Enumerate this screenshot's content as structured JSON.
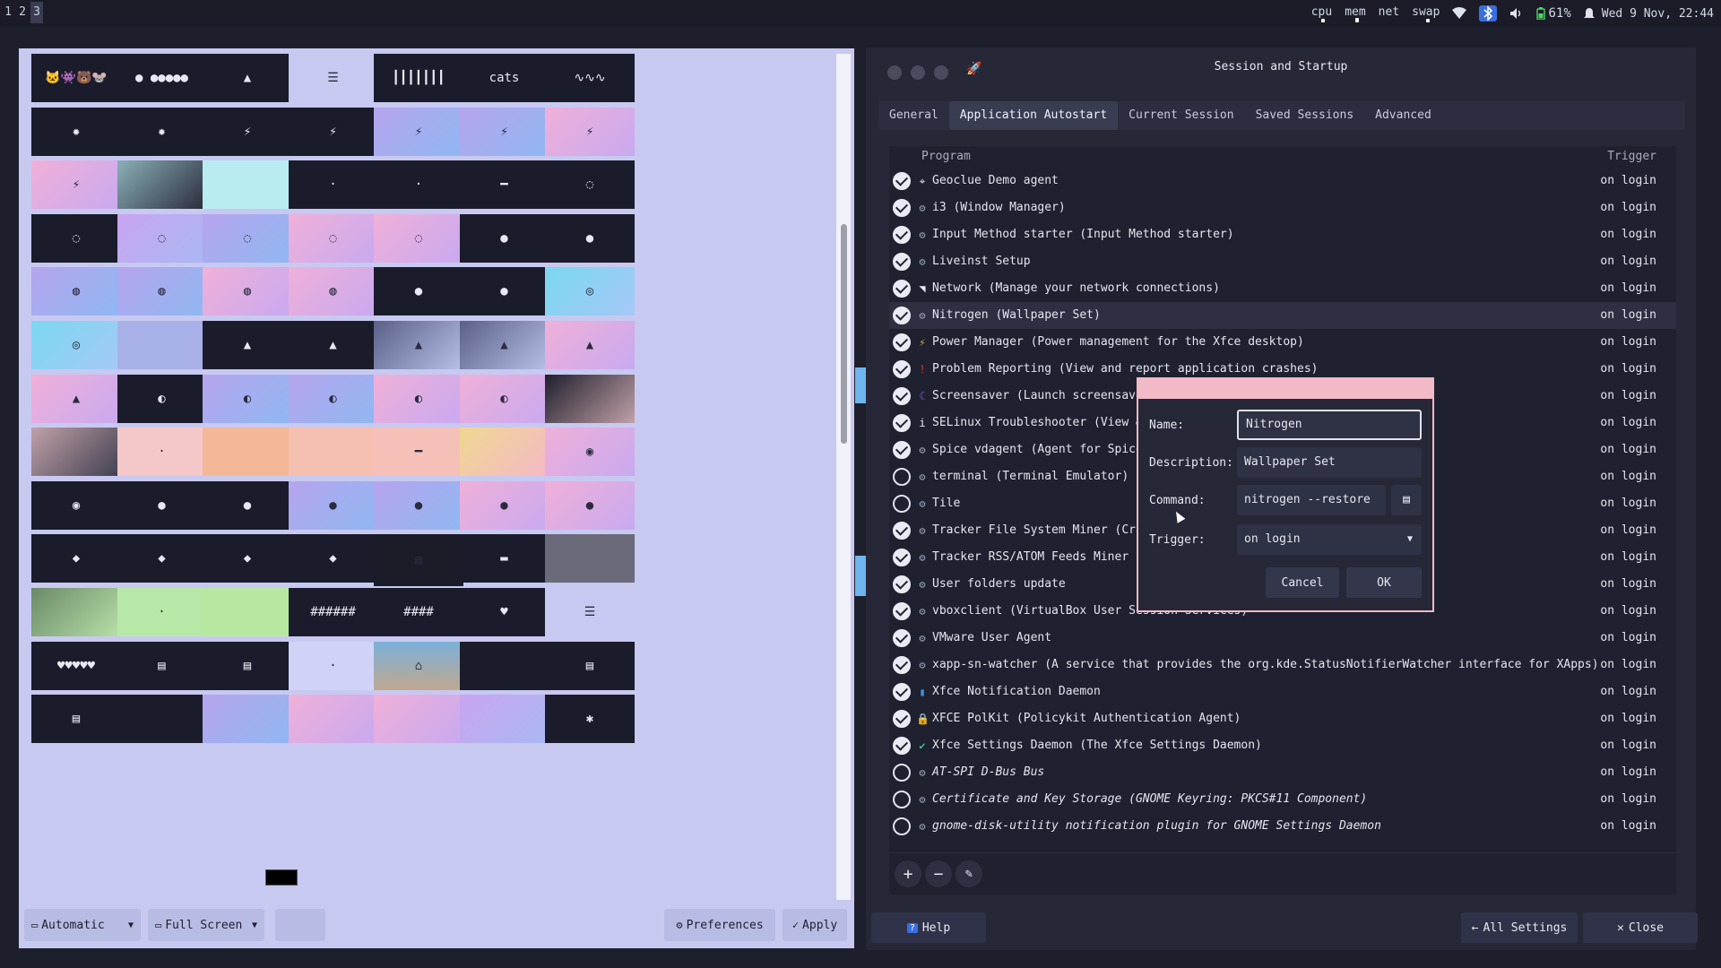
{
  "topbar": {
    "workspaces": [
      "1",
      "2",
      "3"
    ],
    "active_workspace": "3",
    "indicators": [
      {
        "label": "cpu",
        "level": 0.35
      },
      {
        "label": "mem",
        "level": 0.5
      },
      {
        "label": "net",
        "level": 0.0
      },
      {
        "label": "swap",
        "level": 0.4
      }
    ],
    "battery": "61%",
    "datetime": "Wed  9 Nov, 22:44",
    "icons": [
      "wifi-icon",
      "bluetooth-icon",
      "volume-icon",
      "battery-icon",
      "bell-icon"
    ]
  },
  "nitrogen": {
    "thumbnails": [
      [
        "🐱👾🐻🐭",
        "● ●●●●●",
        "▲",
        "☰",
        "┃┃┃┃┃┃┃",
        "cats",
        "∿∿∿"
      ],
      [
        "✹",
        "✹",
        "⚡",
        "⚡",
        "⚡",
        "⚡",
        "⚡"
      ],
      [
        "⚡",
        "",
        "",
        "·",
        "·",
        "━",
        "◌"
      ],
      [
        "◌",
        "◌",
        "◌",
        "◌",
        "◌",
        "●",
        "●"
      ],
      [
        "◍",
        "◍",
        "◍",
        "◍",
        "●",
        "●",
        "◎"
      ],
      [
        "◎",
        "",
        "▲",
        "▲",
        "▲",
        "▲",
        "▲"
      ],
      [
        "▲",
        "◐",
        "◐",
        "◐",
        "◐",
        "◐",
        ""
      ],
      [
        "",
        "·",
        "",
        "",
        "━",
        "",
        "◉"
      ],
      [
        "◉",
        "●",
        "●",
        "●",
        "●",
        "●",
        "●"
      ],
      [
        "◆",
        "◆",
        "◆",
        "◆",
        "▤",
        "▬",
        ""
      ],
      [
        "",
        "·",
        "",
        "######",
        "####",
        "♥",
        "☰"
      ],
      [
        "♥♥♥♥♥",
        "▤",
        "▤",
        "·",
        "⌂",
        "",
        "▤"
      ],
      [
        "▤",
        "",
        "",
        "",
        "",
        "",
        "✱"
      ]
    ],
    "bottom": {
      "mode_label": "Automatic",
      "size_label": "Full Screen",
      "preferences_label": "Preferences",
      "apply_label": "Apply",
      "bg_color": "#000000"
    }
  },
  "session": {
    "title": "Session and Startup",
    "tabs": [
      "General",
      "Application Autostart",
      "Current Session",
      "Saved Sessions",
      "Advanced"
    ],
    "active_tab": "Application Autostart",
    "columns": {
      "program": "Program",
      "trigger": "Trigger"
    },
    "rows": [
      {
        "enabled": true,
        "icon": "location-icon",
        "glyph": "⌖",
        "name": "Geoclue Demo agent",
        "trigger": "on login"
      },
      {
        "enabled": true,
        "icon": "gear-icon",
        "glyph": "⚙",
        "name": "i3 (Window Manager)",
        "trigger": "on login"
      },
      {
        "enabled": true,
        "icon": "gear-icon",
        "glyph": "⚙",
        "name": "Input Method starter (Input Method starter)",
        "trigger": "on login"
      },
      {
        "enabled": true,
        "icon": "gear-icon",
        "glyph": "⚙",
        "name": "Liveinst Setup",
        "trigger": "on login"
      },
      {
        "enabled": true,
        "icon": "wifi-icon",
        "glyph": "◥",
        "name": "Network (Manage your network connections)",
        "trigger": "on login"
      },
      {
        "enabled": true,
        "icon": "gear-icon",
        "glyph": "⚙",
        "name": "Nitrogen (Wallpaper Set)",
        "trigger": "on login",
        "selected": true
      },
      {
        "enabled": true,
        "icon": "power-icon",
        "glyph": "⚡",
        "name": "Power Manager (Power management for the Xfce desktop)",
        "trigger": "on login"
      },
      {
        "enabled": true,
        "icon": "error-icon",
        "glyph": "!",
        "name": "Problem Reporting (View and report application crashes)",
        "trigger": "on login"
      },
      {
        "enabled": true,
        "icon": "screensaver-icon",
        "glyph": "☾",
        "name": "Screensaver (Launch screensaver",
        "trigger": "on login"
      },
      {
        "enabled": true,
        "icon": "info-icon",
        "glyph": "i",
        "name": "SELinux Troubleshooter (View & i",
        "trigger": "on login"
      },
      {
        "enabled": true,
        "icon": "gear-icon",
        "glyph": "⚙",
        "name": "Spice vdagent (Agent for Spice g",
        "trigger": "on login"
      },
      {
        "enabled": false,
        "icon": "gear-icon",
        "glyph": "⚙",
        "name": "terminal (Terminal Emulator)",
        "trigger": "on login"
      },
      {
        "enabled": false,
        "icon": "gear-icon",
        "glyph": "⚙",
        "name": "Tile",
        "trigger": "on login"
      },
      {
        "enabled": true,
        "icon": "gear-icon",
        "glyph": "⚙",
        "name": "Tracker File System Miner (Crawl",
        "trigger": "on login"
      },
      {
        "enabled": true,
        "icon": "gear-icon",
        "glyph": "⚙",
        "name": "Tracker RSS/ATOM Feeds Miner (Fe",
        "trigger": "on login"
      },
      {
        "enabled": true,
        "icon": "gear-icon",
        "glyph": "⚙",
        "name": "User folders update",
        "trigger": "on login"
      },
      {
        "enabled": true,
        "icon": "gear-icon",
        "glyph": "⚙",
        "name": "vboxclient (VirtualBox User Session Services)",
        "trigger": "on login"
      },
      {
        "enabled": true,
        "icon": "gear-icon",
        "glyph": "⚙",
        "name": "VMware User Agent",
        "trigger": "on login"
      },
      {
        "enabled": true,
        "icon": "gear-icon",
        "glyph": "⚙",
        "name": "xapp-sn-watcher (A service that provides the org.kde.StatusNotifierWatcher interface for XApps)",
        "trigger": "on login"
      },
      {
        "enabled": true,
        "icon": "notification-icon",
        "glyph": "▮",
        "name": "Xfce Notification Daemon",
        "trigger": "on login"
      },
      {
        "enabled": true,
        "icon": "lock-icon",
        "glyph": "🔒",
        "name": "XFCE PolKit (Policykit Authentication Agent)",
        "trigger": "on login"
      },
      {
        "enabled": true,
        "icon": "settings-daemon-icon",
        "glyph": "✔",
        "name": "Xfce Settings Daemon (The Xfce Settings Daemon)",
        "trigger": "on login"
      },
      {
        "enabled": false,
        "icon": "gear-icon",
        "glyph": "⚙",
        "name": "AT-SPI D-Bus Bus",
        "trigger": "on login",
        "italic": true
      },
      {
        "enabled": false,
        "icon": "gear-icon",
        "glyph": "⚙",
        "name": "Certificate and Key Storage (GNOME Keyring: PKCS#11 Component)",
        "trigger": "on login",
        "italic": true
      },
      {
        "enabled": false,
        "icon": "gear-icon",
        "glyph": "⚙",
        "name": "gnome-disk-utility notification plugin for GNOME Settings Daemon",
        "trigger": "on login",
        "italic": true
      }
    ],
    "help_label": "Help",
    "all_settings_label": "All Settings",
    "close_label": "Close"
  },
  "dialog": {
    "name_label": "Name:",
    "name_value": "Nitrogen",
    "description_label": "Description:",
    "description_value": "Wallpaper Set",
    "command_label": "Command:",
    "command_value": "nitrogen --restore",
    "trigger_label": "Trigger:",
    "trigger_value": "on login",
    "cancel_label": "Cancel",
    "ok_label": "OK"
  }
}
